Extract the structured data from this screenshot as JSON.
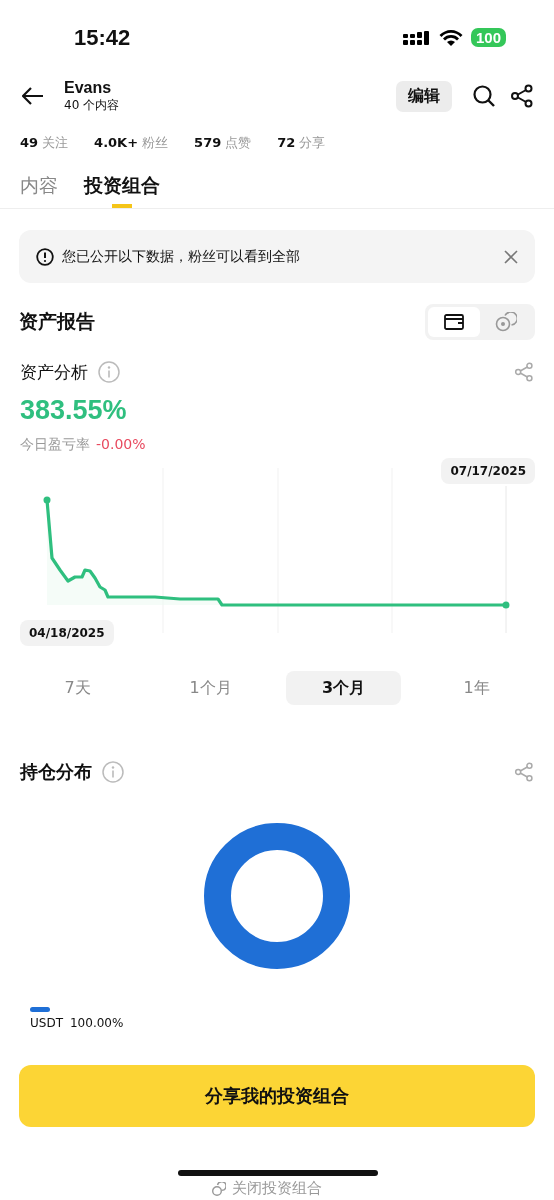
{
  "status_bar": {
    "time": "15:42",
    "battery": "100"
  },
  "header": {
    "name": "Evans",
    "subtitle": "40 个内容",
    "edit_button": "编辑"
  },
  "stats": [
    {
      "value": "49",
      "label": "关注"
    },
    {
      "value": "4.0K+",
      "label": "粉丝"
    },
    {
      "value": "579",
      "label": "点赞"
    },
    {
      "value": "72",
      "label": "分享"
    }
  ],
  "tabs": [
    {
      "label": "内容",
      "selected": false
    },
    {
      "label": "投资组合",
      "selected": true
    }
  ],
  "notice": {
    "text": "您已公开以下数据，粉丝可以看到全部"
  },
  "asset_report": {
    "title": "资产报告",
    "views": [
      {
        "kind": "wallet",
        "selected": true
      },
      {
        "kind": "coin",
        "selected": false
      }
    ]
  },
  "asset_analysis": {
    "title": "资产分析",
    "return": "383.55%",
    "today_label": "今日盈亏率",
    "today_value": "-0.00%",
    "end_date": "07/17/2025",
    "start_date": "04/18/2025"
  },
  "ranges": [
    {
      "label": "7天",
      "selected": false
    },
    {
      "label": "1个月",
      "selected": false
    },
    {
      "label": "3个月",
      "selected": true
    },
    {
      "label": "1年",
      "selected": false
    }
  ],
  "holdings": {
    "title": "持仓分布",
    "legend": [
      {
        "name": "USDT",
        "value": "100.00%",
        "color": "#1f6fd6"
      }
    ]
  },
  "share_button": "分享我的投资组合",
  "close_link": "关闭投资组合"
}
